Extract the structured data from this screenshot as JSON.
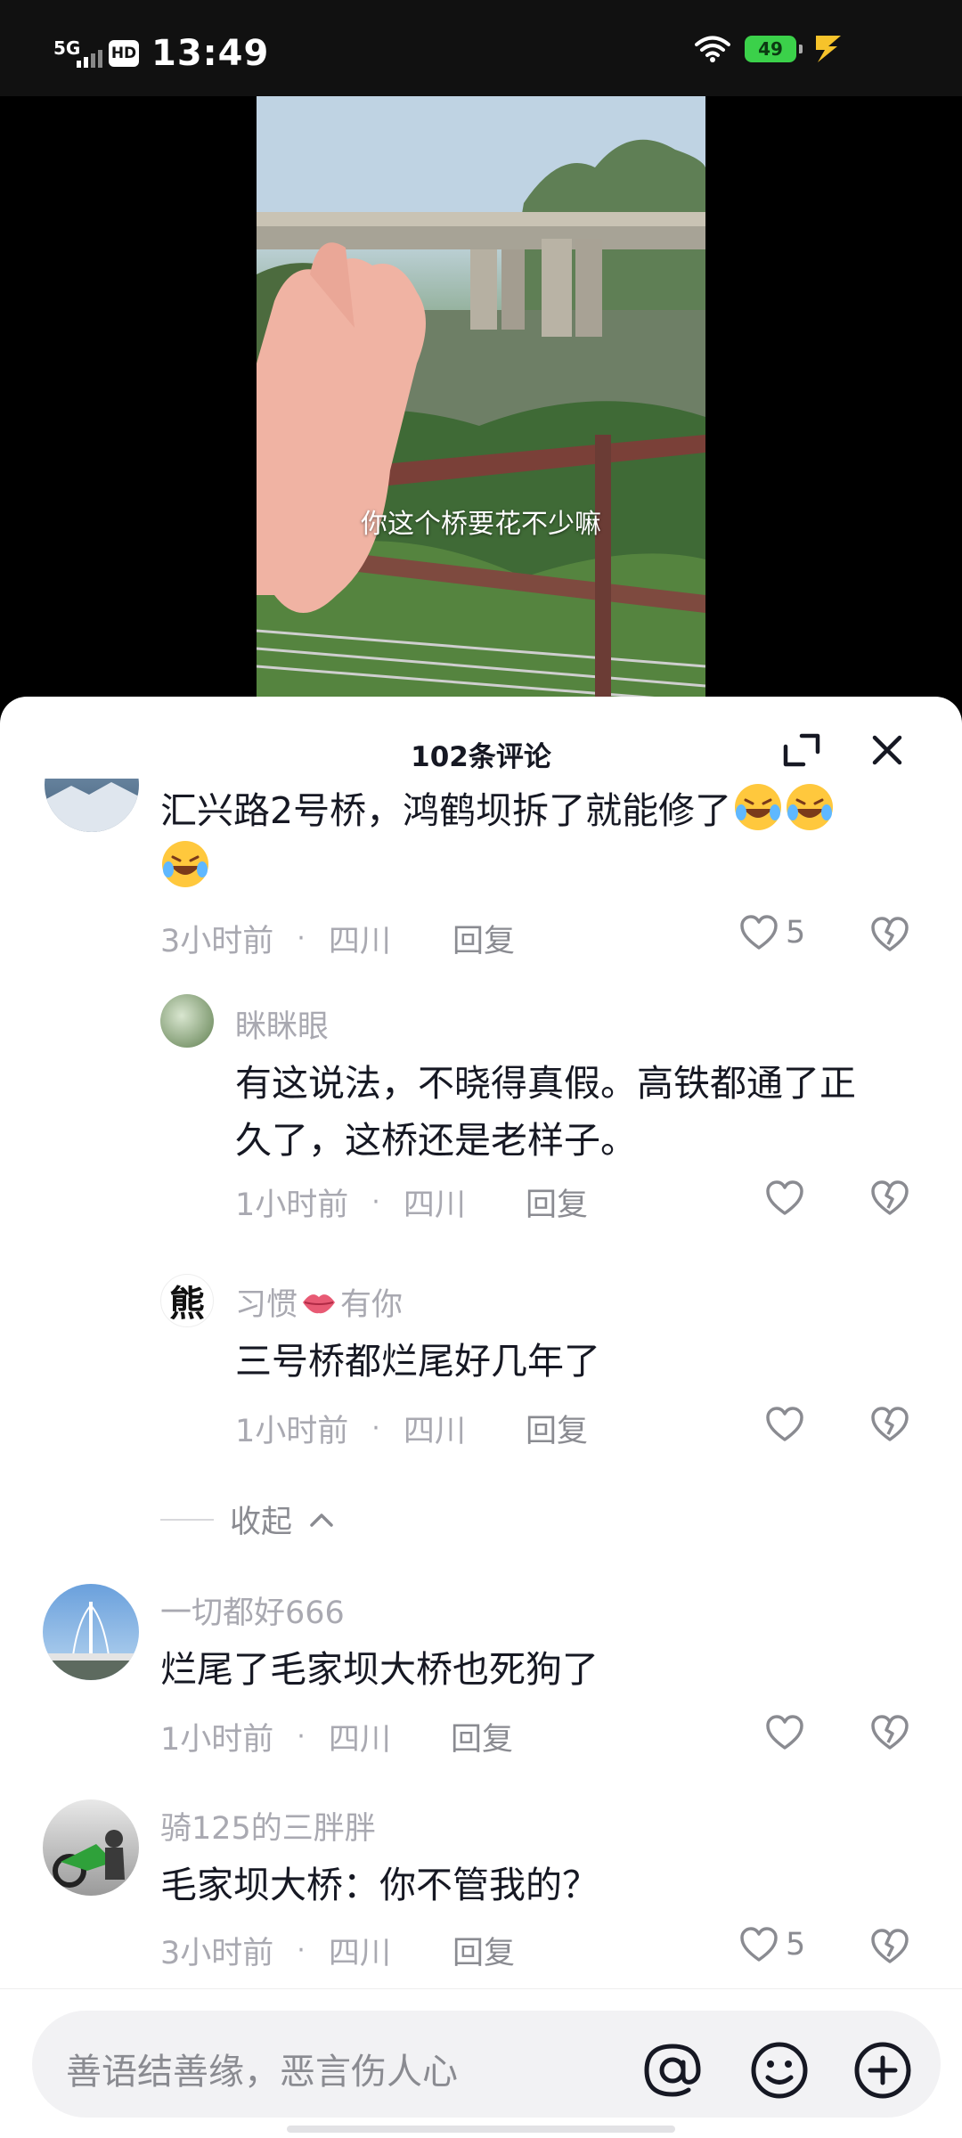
{
  "status_bar": {
    "network": "5G",
    "hd_badge": "HD",
    "time": "13:49",
    "battery": "49"
  },
  "video": {
    "subtitle": "你这个桥要花不少嘛"
  },
  "comments_panel": {
    "title": "102条评论",
    "comments": [
      {
        "text_line1": "汇兴路2号桥，鸿鹤坝拆了就能修了",
        "time": "3小时前",
        "location": "四川",
        "reply_label": "回复",
        "likes": "5"
      },
      {
        "username": "眯眯眼",
        "text_line1": "有这说法，不晓得真假。高铁都通了正",
        "text_line2": "久了，这桥还是老样子。",
        "time": "1小时前",
        "location": "四川",
        "reply_label": "回复"
      },
      {
        "username_prefix": "习惯",
        "username_suffix": "有你",
        "avatar_text": "熊",
        "text_line1": "三号桥都烂尾好几年了",
        "time": "1小时前",
        "location": "四川",
        "reply_label": "回复"
      },
      {
        "username": "一切都好666",
        "text_line1": "烂尾了毛家坝大桥也死狗了",
        "time": "1小时前",
        "location": "四川",
        "reply_label": "回复"
      },
      {
        "username": "骑125的三胖胖",
        "text_line1": "毛家坝大桥：你不管我的？",
        "time": "3小时前",
        "location": "四川",
        "reply_label": "回复",
        "likes": "5"
      }
    ],
    "collapse_label": "收起",
    "dot": "·"
  },
  "input": {
    "placeholder": "善语结善缘，恶言伤人心"
  },
  "icons": [
    "expand-icon",
    "close-icon",
    "heart-icon",
    "broken-heart-icon",
    "at-icon",
    "emoji-icon",
    "plus-icon"
  ]
}
